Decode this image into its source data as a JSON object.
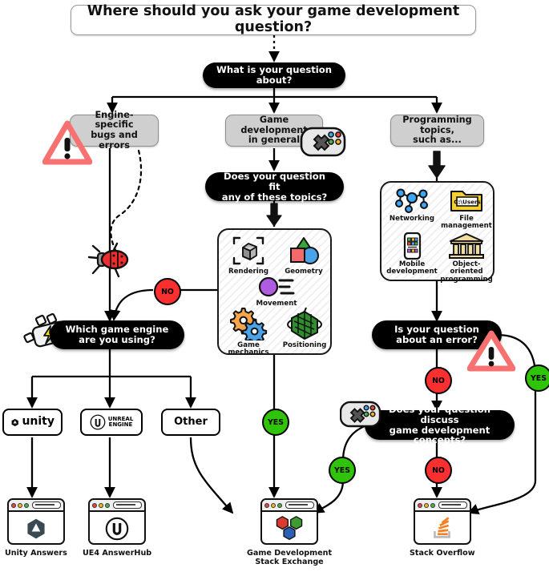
{
  "title": "Where should you ask your game development question?",
  "nodes": {
    "root_question": "What is your question about?",
    "branch_engine": "Engine-specific\nbugs and errors",
    "branch_general": "Game development\nin general",
    "branch_programming": "Programming topics,\nsuch as...",
    "fit_topics": "Does your question fit\nany of these topics?",
    "which_engine": "Which game engine\nare you using?",
    "is_error": "Is your question\nabout an error?",
    "discuss_gamedev": "Does your question discuss\ngame development concepts?"
  },
  "engine_options": [
    {
      "label": "unity",
      "icon": "unity-logo-icon"
    },
    {
      "label": "UNREAL\nENGINE",
      "icon": "unreal-logo-icon"
    },
    {
      "label": "Other",
      "icon": "none"
    }
  ],
  "gamedev_topics": {
    "items": [
      {
        "label": "Rendering",
        "icon": "rendering-cube-icon"
      },
      {
        "label": "Geometry",
        "icon": "geometry-shapes-icon"
      },
      {
        "label": "Movement",
        "icon": "movement-motion-icon"
      },
      {
        "label": "Game\nmechanics",
        "icon": "gears-icon"
      },
      {
        "label": "Positioning",
        "icon": "positioning-grid-sphere-icon"
      }
    ]
  },
  "programming_topics": {
    "items": [
      {
        "label": "Networking",
        "icon": "network-nodes-icon"
      },
      {
        "label": "File\nmanagement",
        "icon": "folder-icon",
        "folder_text": "C:\\Users"
      },
      {
        "label": "Mobile\ndevelopment",
        "icon": "smartphone-icon"
      },
      {
        "label": "Object-oriented\nprogramming",
        "icon": "classical-building-icon"
      }
    ]
  },
  "badges": [
    {
      "id": "no-topics-fit",
      "label": "NO",
      "color": "#fa2f2f"
    },
    {
      "id": "yes-topics-fit",
      "label": "YES",
      "color": "#2fc40a"
    },
    {
      "id": "no-is-error",
      "label": "NO",
      "color": "#fa2f2f"
    },
    {
      "id": "yes-is-error",
      "label": "YES",
      "color": "#2fc40a"
    },
    {
      "id": "yes-discuss-gamedev",
      "label": "YES",
      "color": "#2fc40a"
    },
    {
      "id": "no-discuss-gamedev",
      "label": "NO",
      "color": "#fa2f2f"
    }
  ],
  "endpoints": [
    {
      "id": "unity-answers",
      "label": "Unity Answers",
      "icon": "unity-logo-icon"
    },
    {
      "id": "ue4-answerhub",
      "label": "UE4 AnswerHub",
      "icon": "unreal-logo-icon"
    },
    {
      "id": "gamedev-stackexchange",
      "label": "Game Development\nStack Exchange",
      "icon": "gamedev-se-hexagons-icon"
    },
    {
      "id": "stack-overflow",
      "label": "Stack Overflow",
      "icon": "stack-overflow-icon"
    }
  ],
  "decorations": [
    {
      "id": "warning-engine-bugs",
      "icon": "warning-triangle-icon",
      "color": "#f87171"
    },
    {
      "id": "warning-is-error",
      "icon": "warning-triangle-icon",
      "color": "#f87171"
    },
    {
      "id": "gamepad-general",
      "icon": "gamepad-icon"
    },
    {
      "id": "gamepad-discuss",
      "icon": "gamepad-icon"
    },
    {
      "id": "bug-trail",
      "icon": "bug-icon",
      "color": "#ef2b2b"
    },
    {
      "id": "engine-motor",
      "icon": "engine-motor-icon"
    }
  ],
  "colors": {
    "no": "#fa2f2f",
    "yes": "#2fc40a",
    "warning": "#f87171",
    "grey_box": "#cfcfcf",
    "pill": "#000000",
    "stack_overflow": "#f48024"
  }
}
